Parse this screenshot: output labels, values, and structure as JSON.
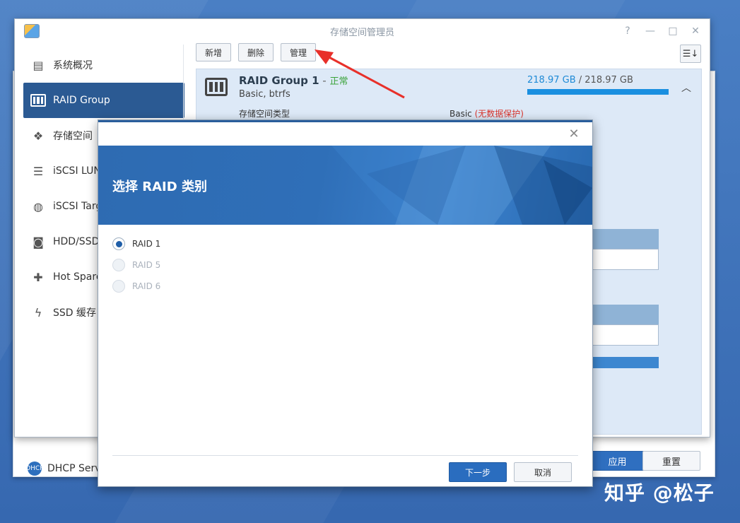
{
  "background_window": {
    "items": [
      {
        "label": "DHCP Server",
        "icon": "dhcp-icon"
      }
    ],
    "apply_label": "应用",
    "reset_label": "重置"
  },
  "window": {
    "title": "存储空间管理员",
    "controls": [
      "?",
      "—",
      "□",
      "✕"
    ]
  },
  "sidebar": {
    "items": [
      {
        "label": "系统概况",
        "icon": "overview-icon",
        "active": false
      },
      {
        "label": "RAID Group",
        "icon": "raid-icon",
        "active": true
      },
      {
        "label": "存储空间",
        "icon": "volume-icon",
        "active": false
      },
      {
        "label": "iSCSI LUN",
        "icon": "database-icon",
        "active": false
      },
      {
        "label": "iSCSI Target",
        "icon": "globe-icon",
        "active": false
      },
      {
        "label": "HDD/SSD",
        "icon": "disk-icon",
        "active": false
      },
      {
        "label": "Hot Spare",
        "icon": "hot-spare-icon",
        "active": false
      },
      {
        "label": "SSD 缓存",
        "icon": "ssd-cache-icon",
        "active": false
      }
    ]
  },
  "toolbar": {
    "create_label": "新增",
    "delete_label": "删除",
    "manage_label": "管理"
  },
  "raid_group": {
    "name": "RAID Group 1",
    "separator": " - ",
    "status": "正常",
    "subtitle": "Basic, btrfs",
    "capacity_used": "218.97 GB",
    "capacity_sep": " / ",
    "capacity_total": "218.97 GB",
    "capacity_fraction": 1.0,
    "type_label": "存储空间类型",
    "type_value": "Basic",
    "type_warning": "(无数据保护)"
  },
  "modal": {
    "title": "选择 RAID 类别",
    "options": [
      {
        "label": "RAID 1",
        "checked": true,
        "disabled": false
      },
      {
        "label": "RAID 5",
        "checked": false,
        "disabled": true
      },
      {
        "label": "RAID 6",
        "checked": false,
        "disabled": true
      }
    ],
    "next_label": "下一步",
    "cancel_label": "取消"
  },
  "watermark": "知乎 @松子",
  "colors": {
    "accent": "#2b5a93",
    "status_ok": "#3aa33a",
    "warning": "#d9342b",
    "capacity": "#1a8fe0",
    "annotation_arrow": "#e8302a"
  }
}
